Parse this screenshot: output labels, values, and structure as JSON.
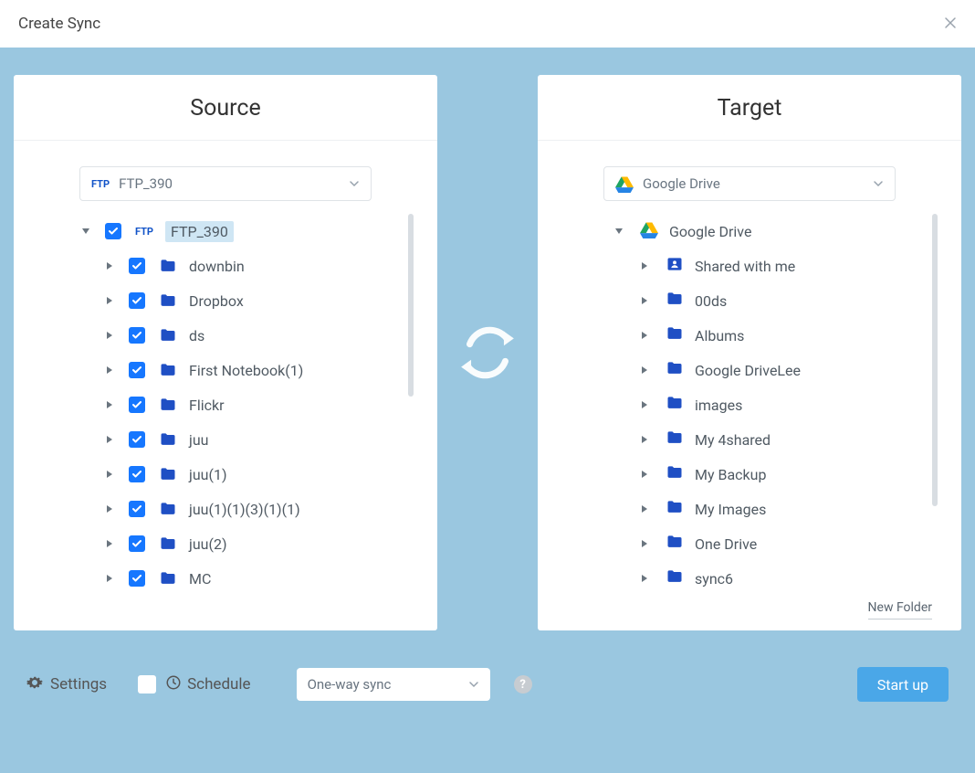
{
  "title": "Create Sync",
  "source": {
    "header": "Source",
    "selector": {
      "icon": "ftp",
      "label": "FTP_390"
    },
    "root": {
      "label": "FTP_390",
      "icon": "ftp",
      "checked": true,
      "expanded": true,
      "highlighted": true
    },
    "items": [
      {
        "label": "downbin",
        "checked": true
      },
      {
        "label": "Dropbox",
        "checked": true
      },
      {
        "label": "ds",
        "checked": true
      },
      {
        "label": "First Notebook(1)",
        "checked": true
      },
      {
        "label": "Flickr",
        "checked": true
      },
      {
        "label": "juu",
        "checked": true
      },
      {
        "label": "juu(1)",
        "checked": true
      },
      {
        "label": "juu(1)(1)(3)(1)(1)",
        "checked": true
      },
      {
        "label": "juu(2)",
        "checked": true
      },
      {
        "label": "MC",
        "checked": true
      }
    ]
  },
  "target": {
    "header": "Target",
    "selector": {
      "icon": "gdrive",
      "label": "Google Drive"
    },
    "root": {
      "label": "Google Drive",
      "icon": "gdrive",
      "expanded": true
    },
    "items": [
      {
        "label": "Shared with me",
        "icon": "shared"
      },
      {
        "label": "00ds"
      },
      {
        "label": "Albums"
      },
      {
        "label": "Google DriveLee"
      },
      {
        "label": "images"
      },
      {
        "label": "My 4shared"
      },
      {
        "label": "My Backup",
        "highlighted": true
      },
      {
        "label": "My Images"
      },
      {
        "label": "One Drive"
      },
      {
        "label": "sync6"
      }
    ],
    "new_folder_label": "New Folder"
  },
  "footer": {
    "settings": "Settings",
    "schedule": "Schedule",
    "mode": "One-way sync",
    "start": "Start up"
  }
}
